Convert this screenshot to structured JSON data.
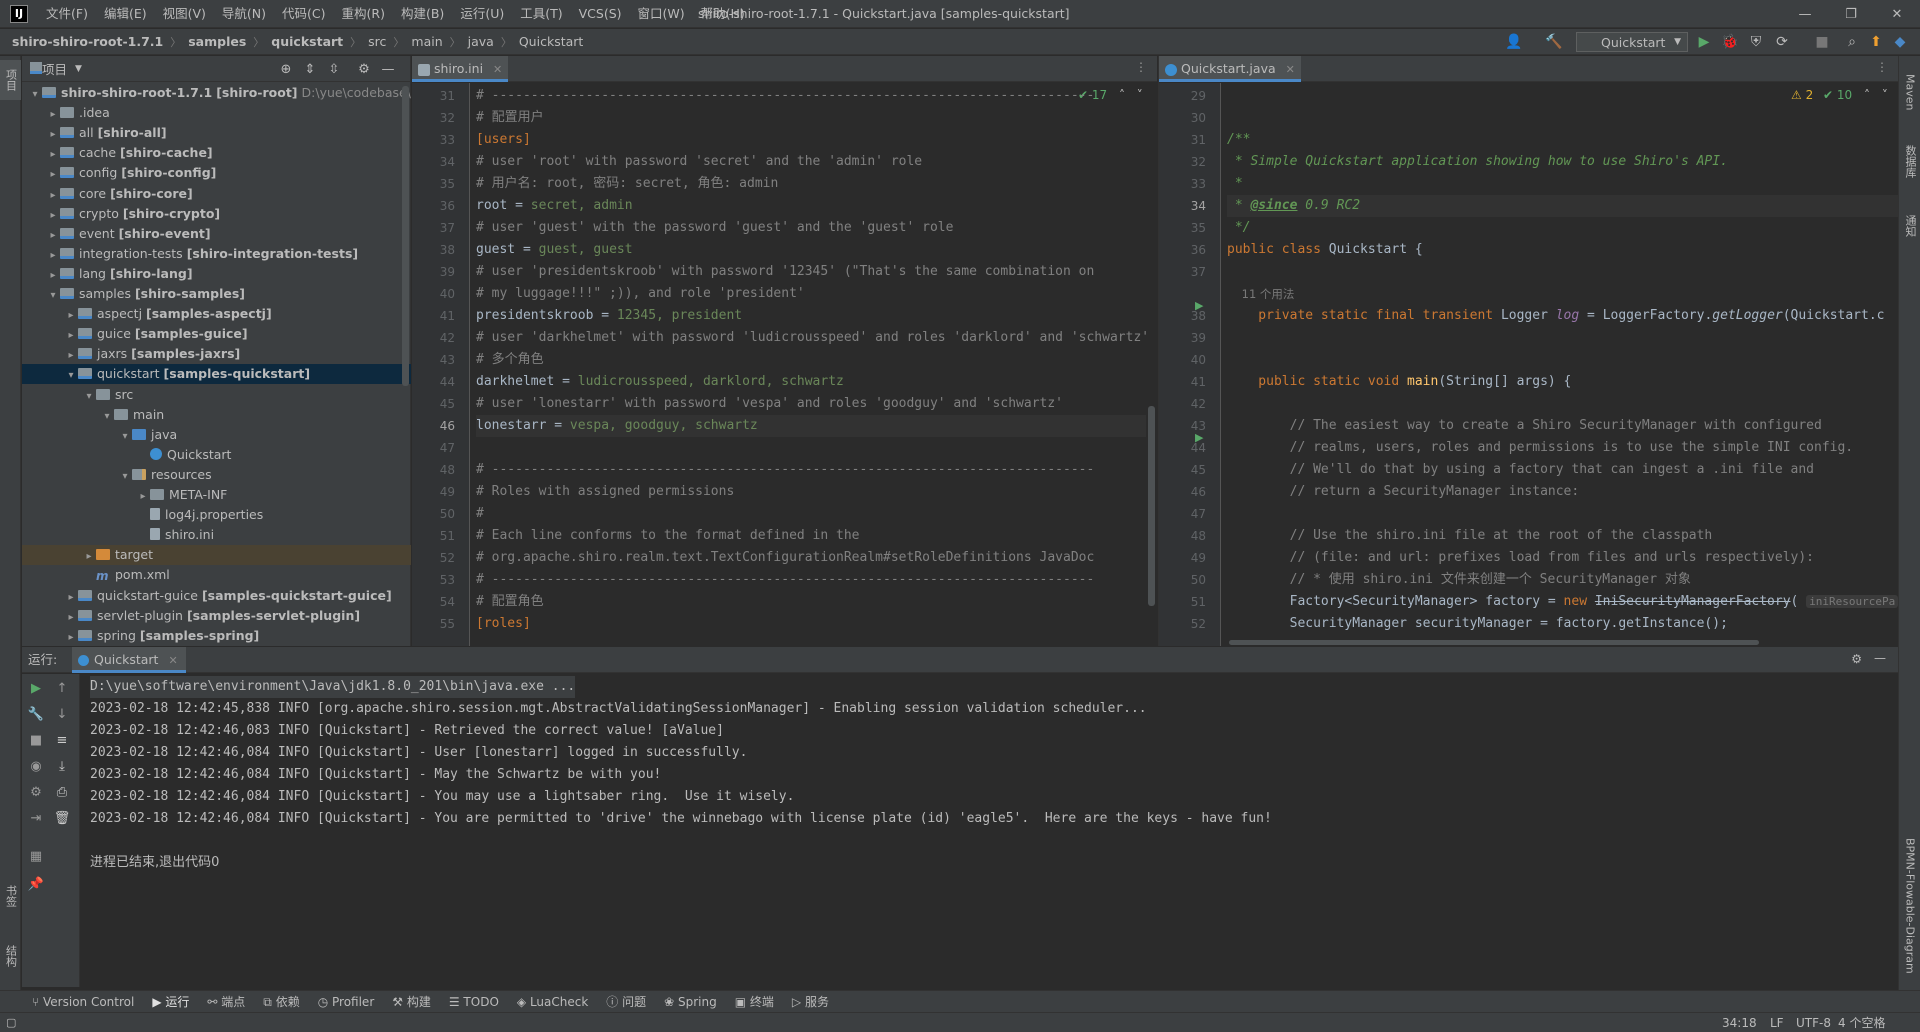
{
  "app": {
    "logo": "IJ",
    "window_title": "shiro-shiro-root-1.7.1 - Quickstart.java [samples-quickstart]",
    "menu": [
      "文件(F)",
      "编辑(E)",
      "视图(V)",
      "导航(N)",
      "代码(C)",
      "重构(R)",
      "构建(B)",
      "运行(U)",
      "工具(T)",
      "VCS(S)",
      "窗口(W)",
      "帮助(H)"
    ]
  },
  "navbar": {
    "breadcrumbs": [
      "shiro-shiro-root-1.7.1",
      "samples",
      "quickstart",
      "src",
      "main",
      "java",
      "Quickstart"
    ],
    "run_config": "Quickstart"
  },
  "left_strip": {
    "project_tab": "项目",
    "bookmarks_tab": "书签",
    "structure_tab": "结构"
  },
  "right_strip": {
    "maven_tab": "Maven",
    "database_tab": "数据库",
    "notifications_tab": "通知",
    "bpmn_tab": "BPMN-Flowable-Diagram"
  },
  "project": {
    "title": "项目",
    "tree": [
      {
        "depth": 0,
        "arrow": "▾",
        "icon": "module",
        "name": "shiro-shiro-root-1.7.1",
        "module": "[shiro-root]",
        "path": "D:\\yue\\codebase\\yue\\"
      },
      {
        "depth": 1,
        "arrow": "▸",
        "icon": "folder",
        "name": ".idea",
        "module": ""
      },
      {
        "depth": 1,
        "arrow": "▸",
        "icon": "module",
        "name": "all",
        "module": "[shiro-all]"
      },
      {
        "depth": 1,
        "arrow": "▸",
        "icon": "module",
        "name": "cache",
        "module": "[shiro-cache]"
      },
      {
        "depth": 1,
        "arrow": "▸",
        "icon": "module",
        "name": "config",
        "module": "[shiro-config]"
      },
      {
        "depth": 1,
        "arrow": "▸",
        "icon": "module",
        "name": "core",
        "module": "[shiro-core]"
      },
      {
        "depth": 1,
        "arrow": "▸",
        "icon": "module",
        "name": "crypto",
        "module": "[shiro-crypto]"
      },
      {
        "depth": 1,
        "arrow": "▸",
        "icon": "module",
        "name": "event",
        "module": "[shiro-event]"
      },
      {
        "depth": 1,
        "arrow": "▸",
        "icon": "module",
        "name": "integration-tests",
        "module": "[shiro-integration-tests]"
      },
      {
        "depth": 1,
        "arrow": "▸",
        "icon": "module",
        "name": "lang",
        "module": "[shiro-lang]"
      },
      {
        "depth": 1,
        "arrow": "▾",
        "icon": "module",
        "name": "samples",
        "module": "[shiro-samples]"
      },
      {
        "depth": 2,
        "arrow": "▸",
        "icon": "module",
        "name": "aspectj",
        "module": "[samples-aspectj]"
      },
      {
        "depth": 2,
        "arrow": "▸",
        "icon": "module",
        "name": "guice",
        "module": "[samples-guice]"
      },
      {
        "depth": 2,
        "arrow": "▸",
        "icon": "module",
        "name": "jaxrs",
        "module": "[samples-jaxrs]"
      },
      {
        "depth": 2,
        "arrow": "▾",
        "icon": "module",
        "name": "quickstart",
        "module": "[samples-quickstart]",
        "selected": true
      },
      {
        "depth": 3,
        "arrow": "▾",
        "icon": "folder",
        "name": "src",
        "module": ""
      },
      {
        "depth": 4,
        "arrow": "▾",
        "icon": "folder",
        "name": "main",
        "module": ""
      },
      {
        "depth": 5,
        "arrow": "▾",
        "icon": "src",
        "name": "java",
        "module": ""
      },
      {
        "depth": 6,
        "arrow": "",
        "icon": "class",
        "name": "Quickstart",
        "module": ""
      },
      {
        "depth": 5,
        "arrow": "▾",
        "icon": "res",
        "name": "resources",
        "module": ""
      },
      {
        "depth": 6,
        "arrow": "▸",
        "icon": "folder",
        "name": "META-INF",
        "module": ""
      },
      {
        "depth": 6,
        "arrow": "",
        "icon": "file",
        "name": "log4j.properties",
        "module": ""
      },
      {
        "depth": 6,
        "arrow": "",
        "icon": "file",
        "name": "shiro.ini",
        "module": ""
      },
      {
        "depth": 3,
        "arrow": "▸",
        "icon": "orange",
        "name": "target",
        "module": "",
        "highlight": true
      },
      {
        "depth": 3,
        "arrow": "",
        "icon": "pom",
        "name": "pom.xml",
        "module": ""
      },
      {
        "depth": 2,
        "arrow": "▸",
        "icon": "module",
        "name": "quickstart-guice",
        "module": "[samples-quickstart-guice]"
      },
      {
        "depth": 2,
        "arrow": "▸",
        "icon": "module",
        "name": "servlet-plugin",
        "module": "[samples-servlet-plugin]"
      },
      {
        "depth": 2,
        "arrow": "▸",
        "icon": "module",
        "name": "spring",
        "module": "[samples-spring]"
      }
    ]
  },
  "left_editor": {
    "tab": "shiro.ini",
    "inspection": "✔ 17",
    "current_line": 46,
    "lines": [
      {
        "n": 31,
        "segs": [
          [
            "c-comment",
            "# -----------------------------------------------------------------------------"
          ]
        ]
      },
      {
        "n": 32,
        "segs": [
          [
            "c-comment",
            "# 配置用户"
          ]
        ]
      },
      {
        "n": 33,
        "segs": [
          [
            "c-section",
            "[users]"
          ]
        ]
      },
      {
        "n": 34,
        "segs": [
          [
            "c-comment",
            "# user 'root' with password 'secret' and the 'admin' role"
          ]
        ]
      },
      {
        "n": 35,
        "segs": [
          [
            "c-comment",
            "# 用户名: root, 密码: secret, 角色: admin"
          ]
        ]
      },
      {
        "n": 36,
        "segs": [
          [
            "c-ident",
            "root = "
          ],
          [
            "c-value",
            "secret, admin"
          ]
        ]
      },
      {
        "n": 37,
        "segs": [
          [
            "c-comment",
            "# user 'guest' with the password 'guest' and the 'guest' role"
          ]
        ]
      },
      {
        "n": 38,
        "segs": [
          [
            "c-ident",
            "guest = "
          ],
          [
            "c-value",
            "guest, guest"
          ]
        ]
      },
      {
        "n": 39,
        "segs": [
          [
            "c-comment",
            "# user 'presidentskroob' with password '12345' (\"That's the same combination on"
          ]
        ]
      },
      {
        "n": 40,
        "segs": [
          [
            "c-comment",
            "# my luggage!!!\" ;)), and role 'president'"
          ]
        ]
      },
      {
        "n": 41,
        "segs": [
          [
            "c-ident",
            "presidentskroob = "
          ],
          [
            "c-value",
            "12345, president"
          ]
        ]
      },
      {
        "n": 42,
        "segs": [
          [
            "c-comment",
            "# user 'darkhelmet' with password 'ludicrousspeed' and roles 'darklord' and 'schwartz'"
          ]
        ]
      },
      {
        "n": 43,
        "segs": [
          [
            "c-comment",
            "# 多个角色"
          ]
        ]
      },
      {
        "n": 44,
        "segs": [
          [
            "c-ident",
            "darkhelmet = "
          ],
          [
            "c-value",
            "ludicrousspeed, darklord, schwartz"
          ]
        ]
      },
      {
        "n": 45,
        "segs": [
          [
            "c-comment",
            "# user 'lonestarr' with password 'vespa' and roles 'goodguy' and 'schwartz'"
          ]
        ]
      },
      {
        "n": 46,
        "segs": [
          [
            "c-ident",
            "lonestarr = "
          ],
          [
            "c-value",
            "vespa, goodguy, schwartz"
          ]
        ]
      },
      {
        "n": 47,
        "segs": []
      },
      {
        "n": 48,
        "segs": [
          [
            "c-comment",
            "# -----------------------------------------------------------------------------"
          ]
        ]
      },
      {
        "n": 49,
        "segs": [
          [
            "c-comment",
            "# Roles with assigned permissions"
          ]
        ]
      },
      {
        "n": 50,
        "segs": [
          [
            "c-comment",
            "#"
          ]
        ]
      },
      {
        "n": 51,
        "segs": [
          [
            "c-comment",
            "# Each line conforms to the format defined in the"
          ]
        ]
      },
      {
        "n": 52,
        "segs": [
          [
            "c-comment",
            "# org.apache.shiro.realm.text.TextConfigurationRealm#setRoleDefinitions JavaDoc"
          ]
        ]
      },
      {
        "n": 53,
        "segs": [
          [
            "c-comment",
            "# -----------------------------------------------------------------------------"
          ]
        ]
      },
      {
        "n": 54,
        "segs": [
          [
            "c-comment",
            "# 配置角色"
          ]
        ]
      },
      {
        "n": 55,
        "segs": [
          [
            "c-section",
            "[roles]"
          ]
        ]
      }
    ]
  },
  "right_editor": {
    "tab": "Quickstart.java",
    "warnings": "⚠ 2",
    "checks": "✔ 10",
    "current_line": 34,
    "lines": [
      {
        "n": 29,
        "segs": []
      },
      {
        "n": 30,
        "segs": []
      },
      {
        "n": 31,
        "segs": [
          [
            "c-doc",
            "/**"
          ]
        ]
      },
      {
        "n": 32,
        "segs": [
          [
            "c-doc",
            " * Simple Quickstart application showing how to use Shiro's API."
          ]
        ]
      },
      {
        "n": 33,
        "segs": [
          [
            "c-doc",
            " *"
          ]
        ]
      },
      {
        "n": 34,
        "segs": [
          [
            "c-doc",
            " * "
          ],
          [
            "c-doctag",
            "@since"
          ],
          [
            "c-doc",
            " 0.9 RC2"
          ]
        ]
      },
      {
        "n": 35,
        "segs": [
          [
            "c-doc",
            " */"
          ]
        ]
      },
      {
        "n": 36,
        "segs": [
          [
            "c-kw",
            "public class "
          ],
          [
            "c-ident",
            "Quickstart {"
          ]
        ]
      },
      {
        "n": 37,
        "segs": []
      },
      {
        "n": "",
        "segs": [
          [
            "c-usages",
            "    11 个用法"
          ]
        ]
      },
      {
        "n": 38,
        "segs": [
          [
            "c-kw",
            "    private static final transient "
          ],
          [
            "c-ident",
            "Logger "
          ],
          [
            "c-field",
            "log"
          ],
          [
            "c-ident",
            " = LoggerFactory."
          ],
          [
            "c-static",
            "getLogger"
          ],
          [
            "c-ident",
            "(Quickstart.c"
          ]
        ]
      },
      {
        "n": 39,
        "segs": []
      },
      {
        "n": 40,
        "segs": []
      },
      {
        "n": 41,
        "segs": [
          [
            "c-kw",
            "    public static void "
          ],
          [
            "c-method",
            "main"
          ],
          [
            "c-ident",
            "(String[] args) {"
          ]
        ]
      },
      {
        "n": 42,
        "segs": []
      },
      {
        "n": 43,
        "segs": [
          [
            "c-comment",
            "        // The easiest way to create a Shiro SecurityManager with configured"
          ]
        ]
      },
      {
        "n": 44,
        "segs": [
          [
            "c-comment",
            "        // realms, users, roles and permissions is to use the simple INI config."
          ]
        ]
      },
      {
        "n": 45,
        "segs": [
          [
            "c-comment",
            "        // We'll do that by using a factory that can ingest a .ini file and"
          ]
        ]
      },
      {
        "n": 46,
        "segs": [
          [
            "c-comment",
            "        // return a SecurityManager instance:"
          ]
        ]
      },
      {
        "n": 47,
        "segs": []
      },
      {
        "n": 48,
        "segs": [
          [
            "c-comment",
            "        // Use the shiro.ini file at the root of the classpath"
          ]
        ]
      },
      {
        "n": 49,
        "segs": [
          [
            "c-comment",
            "        // (file: and url: prefixes load from files and urls respectively):"
          ]
        ]
      },
      {
        "n": 50,
        "segs": [
          [
            "c-comment",
            "        // * 使用 shiro.ini 文件来创建一个 SecurityManager 对象"
          ]
        ]
      },
      {
        "n": 51,
        "segs": [
          [
            "c-ident",
            "        Factory<SecurityManager> factory = "
          ],
          [
            "c-kw",
            "new "
          ],
          [
            "c-strike",
            "IniSecurityManagerFactory"
          ],
          [
            "c-ident",
            "( "
          ],
          [
            "c-hint",
            "iniResourcePa"
          ]
        ]
      },
      {
        "n": 52,
        "segs": [
          [
            "c-ident",
            "        SecurityManager securityManager = factory.getInstance();"
          ]
        ]
      }
    ]
  },
  "run": {
    "label": "运行:",
    "tab": "Quickstart",
    "console": [
      "D:\\yue\\software\\environment\\Java\\jdk1.8.0_201\\bin\\java.exe ...",
      "2023-02-18 12:42:45,838 INFO [org.apache.shiro.session.mgt.AbstractValidatingSessionManager] - Enabling session validation scheduler...",
      "2023-02-18 12:42:46,083 INFO [Quickstart] - Retrieved the correct value! [aValue]",
      "2023-02-18 12:42:46,084 INFO [Quickstart] - User [lonestarr] logged in successfully.",
      "2023-02-18 12:42:46,084 INFO [Quickstart] - May the Schwartz be with you!",
      "2023-02-18 12:42:46,084 INFO [Quickstart] - You may use a lightsaber ring.  Use it wisely.",
      "2023-02-18 12:42:46,084 INFO [Quickstart] - You are permitted to 'drive' the winnebago with license plate (id) 'eagle5'.  Here are the keys - have fun!",
      "",
      "进程已结束,退出代码0"
    ]
  },
  "toolwindows": [
    "Version Control",
    "运行",
    "端点",
    "依赖",
    "Profiler",
    "构建",
    "TODO",
    "LuaCheck",
    "问题",
    "Spring",
    "终端",
    "服务"
  ],
  "status": {
    "position": "34:18",
    "line_sep": "LF",
    "encoding": "UTF-8",
    "indent": "4 个空格"
  },
  "colors": {
    "accent": "#4a88c7",
    "run_green": "#59a869",
    "background": "#2b2b2b",
    "panel": "#3c3f41"
  }
}
